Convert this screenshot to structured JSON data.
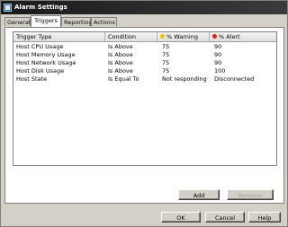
{
  "window": {
    "title": "Alarm Settings",
    "icon": "alarm-settings-icon"
  },
  "tabs": [
    {
      "label": "General",
      "active": false
    },
    {
      "label": "Triggers",
      "active": true
    },
    {
      "label": "Reporting",
      "active": false
    },
    {
      "label": "Actions",
      "active": false
    }
  ],
  "table": {
    "headers": {
      "type": "Trigger Type",
      "condition": "Condition",
      "warning": "% Warning",
      "alert": "% Alert"
    },
    "warning_color": "#f2c200",
    "alert_color": "#e02010",
    "rows": [
      {
        "type": "Host CPU Usage",
        "condition": "Is Above",
        "warning": "75",
        "alert": "90"
      },
      {
        "type": "Host Memory Usage",
        "condition": "Is Above",
        "warning": "75",
        "alert": "90"
      },
      {
        "type": "Host Network Usage",
        "condition": "Is Above",
        "warning": "75",
        "alert": "90"
      },
      {
        "type": "Host Disk Usage",
        "condition": "Is Above",
        "warning": "75",
        "alert": "100"
      },
      {
        "type": "Host State",
        "condition": "Is Equal To",
        "warning": "Not responding",
        "alert": "Disconnected"
      }
    ]
  },
  "panel_buttons": {
    "add": "Add",
    "remove": "Remove"
  },
  "dialog_buttons": {
    "ok": "OK",
    "cancel": "Cancel",
    "help": "Help"
  }
}
